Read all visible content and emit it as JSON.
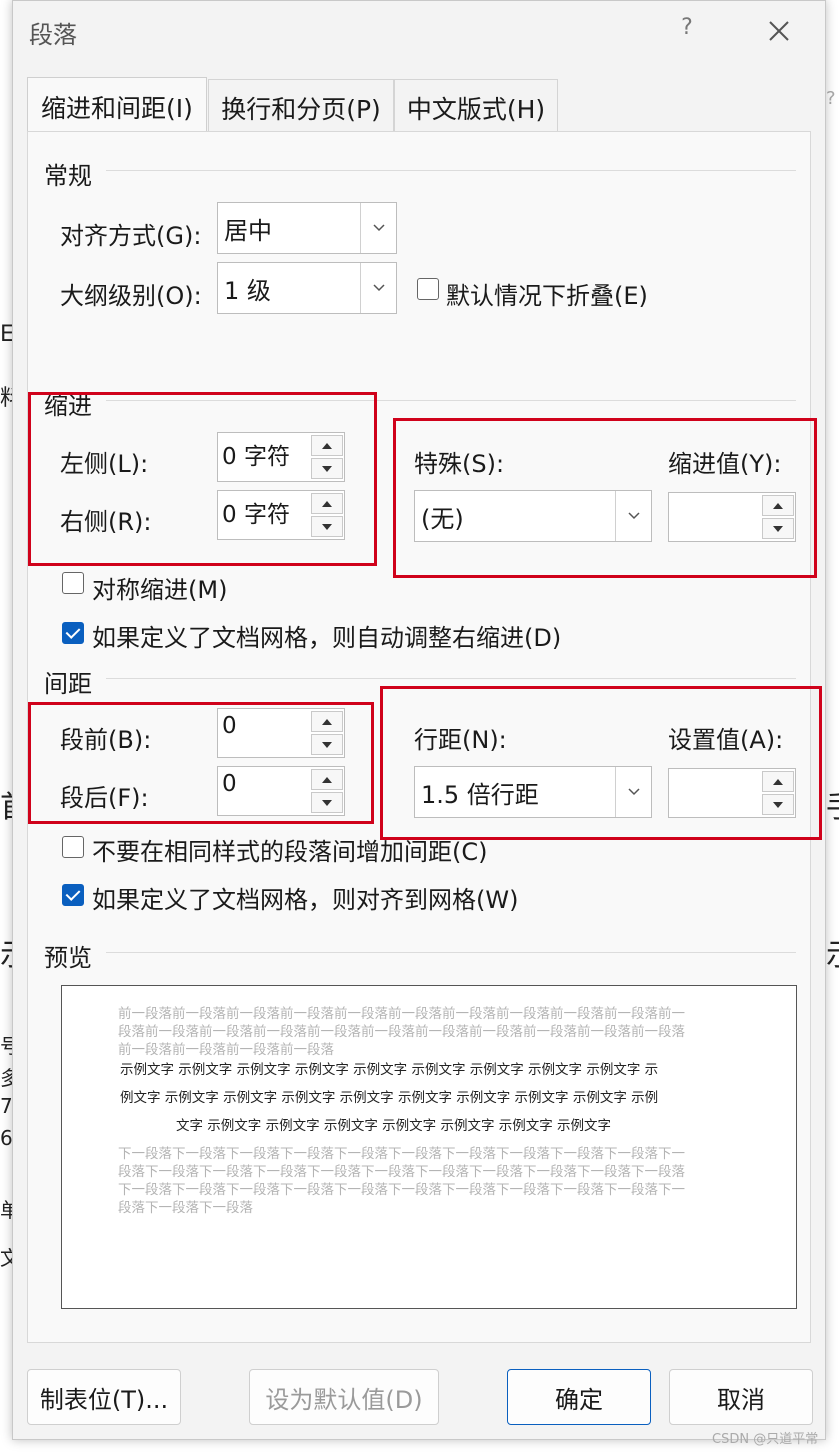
{
  "dialog": {
    "title": "段落",
    "help_label": "?"
  },
  "tabs": [
    {
      "label": "缩进和间距(I)",
      "active": true
    },
    {
      "label": "换行和分页(P)",
      "active": false
    },
    {
      "label": "中文版式(H)",
      "active": false
    }
  ],
  "general": {
    "section_title": "常规",
    "alignment_label": "对齐方式(G):",
    "alignment_value": "居中",
    "outline_label": "大纲级别(O):",
    "outline_value": "1 级",
    "collapse_label": "默认情况下折叠(E)",
    "collapse_checked": false
  },
  "indent": {
    "section_title": "缩进",
    "left_label": "左侧(L):",
    "left_value": "0 字符",
    "right_label": "右侧(R):",
    "right_value": "0 字符",
    "special_label": "特殊(S):",
    "special_value": "(无)",
    "by_label": "缩进值(Y):",
    "by_value": "",
    "mirror_label": "对称缩进(M)",
    "mirror_checked": false,
    "auto_adjust_label": "如果定义了文档网格，则自动调整右缩进(D)",
    "auto_adjust_checked": true
  },
  "spacing": {
    "section_title": "间距",
    "before_label": "段前(B):",
    "before_value": "0",
    "after_label": "段后(F):",
    "after_value": "0",
    "line_label": "行距(N):",
    "line_value": "1.5 倍行距",
    "at_label": "设置值(A):",
    "at_value": "",
    "no_space_label": "不要在相同样式的段落间增加间距(C)",
    "no_space_checked": false,
    "snap_grid_label": "如果定义了文档网格，则对齐到网格(W)",
    "snap_grid_checked": true
  },
  "preview": {
    "section_title": "预览",
    "prev_lines": [
      "前一段落前一段落前一段落前一段落前一段落前一段落前一段落前一段落前一段落前一段落前一",
      "段落前一段落前一段落前一段落前一段落前一段落前一段落前一段落前一段落前一段落前一段落",
      "前一段落前一段落前一段落前一段落"
    ],
    "sample_lines": [
      "示例文字 示例文字 示例文字 示例文字 示例文字 示例文字 示例文字 示例文字 示例文字 示",
      "例文字 示例文字 示例文字 示例文字 示例文字 示例文字 示例文字 示例文字 示例文字 示例",
      "文字 示例文字 示例文字 示例文字 示例文字 示例文字 示例文字 示例文字"
    ],
    "next_lines": [
      "下一段落下一段落下一段落下一段落下一段落下一段落下一段落下一段落下一段落下一段落下一",
      "段落下一段落下一段落下一段落下一段落下一段落下一段落下一段落下一段落下一段落下一段落",
      "下一段落下一段落下一段落下一段落下一段落下一段落下一段落下一段落下一段落下一段落下一",
      "段落下一段落下一段落"
    ]
  },
  "buttons": {
    "tabs_label": "制表位(T)...",
    "default_label": "设为默认值(D)",
    "ok_label": "确定",
    "cancel_label": "取消"
  },
  "watermark": "CSDN @只道平常",
  "colors": {
    "accent": "#0a5fbf",
    "highlight_box": "#d0021b",
    "dialog_bg": "#f3f3f3"
  }
}
